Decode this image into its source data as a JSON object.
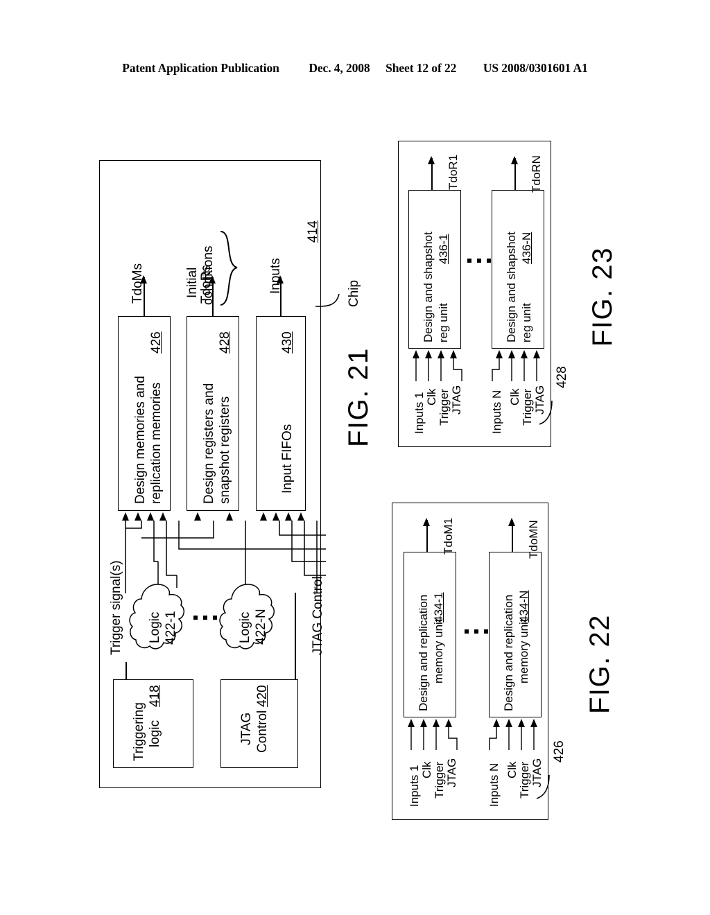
{
  "header": {
    "publication": "Patent Application Publication",
    "date": "Dec. 4, 2008",
    "sheet": "Sheet 12 of 22",
    "patent_number": "US 2008/0301601 A1"
  },
  "figures": [
    {
      "id": "fig21",
      "title": "FIG. 21",
      "frame_ref": "414",
      "frame_callout": "Chip",
      "brace_label_line1": "Initial",
      "brace_label_line2": "conditions",
      "left_edge_label": "Trigger signal(s)",
      "right_edge_label": "JTAG Control",
      "output_labels": [
        "TdoMs",
        "TdoRs",
        "Inputs"
      ],
      "boxes": [
        {
          "name": "design-memories-box",
          "line1": "Design memories and",
          "line2": "replication memories",
          "ref": "426",
          "arrows_in": 4,
          "output": "TdoMs"
        },
        {
          "name": "design-registers-box",
          "line1": "Design registers and",
          "line2": "snapshot registers",
          "ref": "428",
          "arrows_in": 2,
          "output": "TdoRs"
        },
        {
          "name": "input-fifos-box",
          "line1": "Input FIFOs",
          "line2": "",
          "ref": "430",
          "arrows_in": 4,
          "output": "Inputs"
        }
      ],
      "clouds": [
        {
          "name": "logic-cloud-1",
          "line1": "Logic",
          "line2": "422-1"
        },
        {
          "name": "logic-cloud-n",
          "line1": "Logic",
          "line2": "422-N"
        }
      ],
      "ellipsis_dots": 3,
      "bottom_boxes": [
        {
          "name": "triggering-logic-box",
          "line1": "Triggering",
          "line2": "logic",
          "ref": "418"
        },
        {
          "name": "jtag-control-box",
          "line1": "JTAG",
          "line2": "Control",
          "ref": "420"
        }
      ]
    },
    {
      "id": "fig23",
      "title": "FIG. 23",
      "frame_ref": "428",
      "units": [
        {
          "name": "design-snapshot-reg-unit-1",
          "line1": "Design and shapshot",
          "line2": "reg unit",
          "ref": "436-1",
          "output": "TdoR1",
          "inputs": [
            "Inputs 1",
            "Clk",
            "Trigger",
            "JTAG"
          ]
        },
        {
          "name": "design-snapshot-reg-unit-n",
          "line1": "Design and shapshot",
          "line2": "reg unit",
          "ref": "436-N",
          "output": "TdoRN",
          "inputs": [
            "Inputs N",
            "Clk",
            "Trigger",
            "JTAG"
          ]
        }
      ],
      "ellipsis_dots": 3
    },
    {
      "id": "fig22",
      "title": "FIG. 22",
      "frame_ref": "426",
      "units": [
        {
          "name": "design-replication-memory-unit-1",
          "line1": "Design and replication",
          "line2": "memory unit",
          "ref": "434-1",
          "output": "TdoM1",
          "inputs": [
            "Inputs 1",
            "Clk",
            "Trigger",
            "JTAG"
          ]
        },
        {
          "name": "design-replication-memory-unit-n",
          "line1": "Design and replication",
          "line2": "memory unit",
          "ref": "434-N",
          "output": "TdoMN",
          "inputs": [
            "Inputs N",
            "Clk",
            "Trigger",
            "JTAG"
          ]
        }
      ],
      "ellipsis_dots": 3
    }
  ],
  "colors": {
    "ink": "#000000",
    "paper": "#ffffff"
  }
}
